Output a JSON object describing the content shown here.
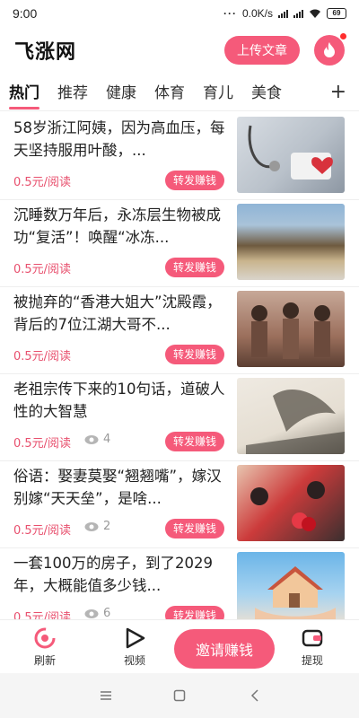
{
  "status_bar": {
    "time": "9:00",
    "network_speed": "0.0K/s",
    "battery": "69"
  },
  "header": {
    "title": "飞涨网",
    "upload_label": "上传文章"
  },
  "tabs": {
    "items": [
      "热门",
      "推荐",
      "健康",
      "体育",
      "育儿",
      "美食"
    ],
    "add": "+"
  },
  "articles": [
    {
      "title": "58岁浙江阿姨，因为高血压，每天坚持服用叶酸，...",
      "price": "0.5元/阅读",
      "views": "",
      "share_label": "转发赚钱"
    },
    {
      "title": "沉睡数万年后，永冻层生物被成功“复活”！唤醒“冰冻...",
      "price": "0.5元/阅读",
      "views": "",
      "share_label": "转发赚钱"
    },
    {
      "title": "被抛弃的“香港大姐大”沈殿霞，背后的7位江湖大哥不...",
      "price": "0.5元/阅读",
      "views": "",
      "share_label": "转发赚钱"
    },
    {
      "title": "老祖宗传下来的10句话，道破人性的大智慧",
      "price": "0.5元/阅读",
      "views": "4",
      "share_label": "转发赚钱"
    },
    {
      "title": "俗语：娶妻莫娶“翘翘嘴”，嫁汉别嫁“天天垒”，是啥...",
      "price": "0.5元/阅读",
      "views": "2",
      "share_label": "转发赚钱"
    },
    {
      "title": "一套100万的房子，到了2029年，大概能值多少钱...",
      "price": "0.5元/阅读",
      "views": "6",
      "share_label": "转发赚钱"
    }
  ],
  "bottom_nav": {
    "refresh_label": "刷新",
    "video_label": "视频",
    "invite_label": "邀请赚钱",
    "withdraw_label": "提现"
  },
  "colors": {
    "accent": "#f55a7a",
    "price": "#e8506e"
  }
}
